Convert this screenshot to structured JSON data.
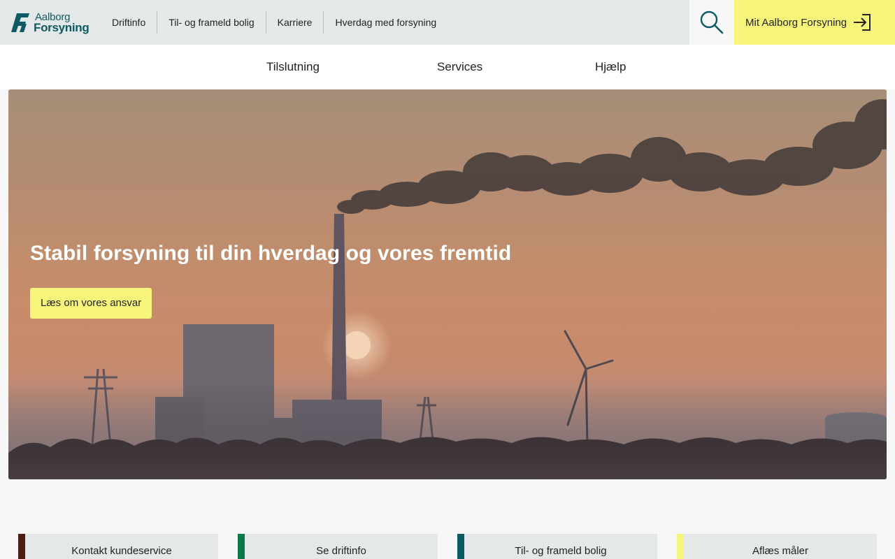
{
  "brand": {
    "logo_line1": "Aalborg",
    "logo_line2": "Forsyning",
    "color": "#0e5a63"
  },
  "utility_nav": [
    {
      "label": "Driftinfo"
    },
    {
      "label": "Til- og frameld bolig"
    },
    {
      "label": "Karriere"
    },
    {
      "label": "Hverdag med forsyning"
    }
  ],
  "search": {
    "icon": "search-icon"
  },
  "login": {
    "label": "Mit Aalborg Forsyning",
    "icon": "login-arrow-icon",
    "color": "#f7f47b"
  },
  "main_nav": [
    {
      "label": "Tilslutning"
    },
    {
      "label": "Services"
    },
    {
      "label": "Hjælp"
    }
  ],
  "hero": {
    "title": "Stabil forsyning til din hverdag og vores fremtid",
    "cta_label": "Læs om vores ansvar"
  },
  "quick_links": [
    {
      "label": "Kontakt kundeservice",
      "accent": "#4a1e12"
    },
    {
      "label": "Se driftinfo",
      "accent": "#0a7a4a"
    },
    {
      "label": "Til- og frameld bolig",
      "accent": "#0e5a63"
    },
    {
      "label": "Aflæs måler",
      "accent": "#f7f47b"
    }
  ]
}
